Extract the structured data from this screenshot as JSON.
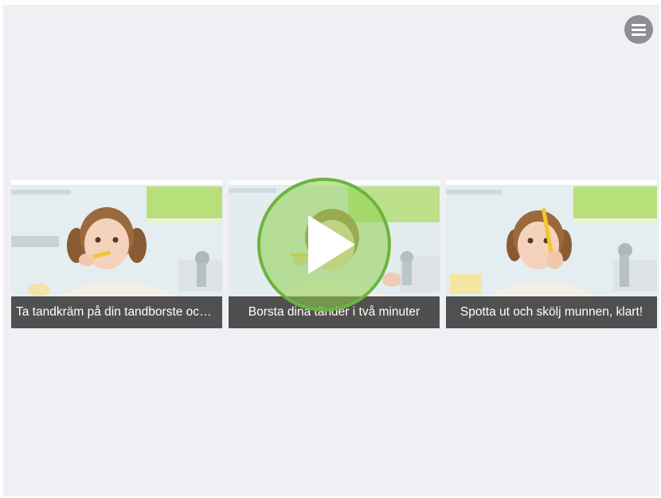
{
  "menu": {
    "icon": "hamburger-menu-icon"
  },
  "cards": [
    {
      "caption": "Ta tandkräm på din tandborste och…"
    },
    {
      "caption": "Borsta dina tänder i två minuter"
    },
    {
      "caption": "Spotta ut och skölj munnen, klart!"
    }
  ],
  "play_overlay": {
    "icon": "play-icon",
    "ring_color": "#6db33f"
  },
  "colors": {
    "background": "#efeff4",
    "caption_bg": "#2d2d2d",
    "accent_green": "#8fd14f"
  }
}
